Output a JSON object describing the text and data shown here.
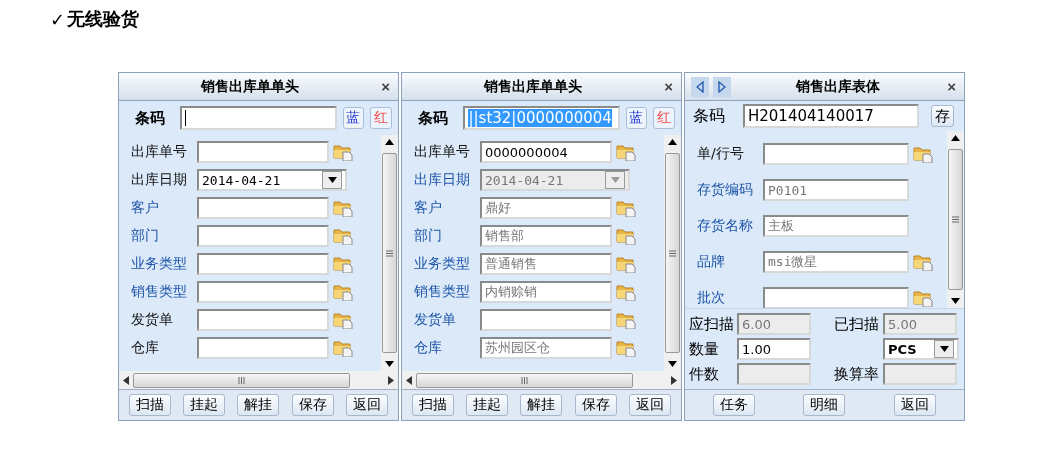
{
  "heading": {
    "mark": "✓",
    "text": "无线验货"
  },
  "panels": [
    {
      "kind": "header",
      "title": "销售出库单单头",
      "close": "×",
      "barcode": {
        "label": "条码"
      },
      "color_buttons": [
        {
          "label": "蓝",
          "color": "#1a2fd0"
        },
        {
          "label": "红",
          "color": "#f04848"
        }
      ],
      "fields": [
        {
          "label": "出库单号",
          "linked": false,
          "kind": "text",
          "lookup": true
        },
        {
          "label": "出库日期",
          "linked": false,
          "kind": "date",
          "value": "2014-04-21",
          "readonly": false
        },
        {
          "label": "客户",
          "linked": true,
          "kind": "text",
          "lookup": true
        },
        {
          "label": "部门",
          "linked": true,
          "kind": "text",
          "lookup": true
        },
        {
          "label": "业务类型",
          "linked": true,
          "kind": "text",
          "lookup": true
        },
        {
          "label": "销售类型",
          "linked": true,
          "kind": "text",
          "lookup": true
        },
        {
          "label": "发货单",
          "linked": false,
          "kind": "text",
          "lookup": true
        },
        {
          "label": "仓库",
          "linked": false,
          "kind": "text",
          "lookup": true
        }
      ],
      "buttons": [
        "扫描",
        "挂起",
        "解挂",
        "保存",
        "返回"
      ]
    },
    {
      "kind": "header",
      "title": "销售出库单单头",
      "close": "×",
      "barcode": {
        "label": "条码",
        "value": "||st32|0000000004",
        "selected": true
      },
      "color_buttons": [
        {
          "label": "蓝",
          "color": "#1a2fd0"
        },
        {
          "label": "红",
          "color": "#f04848"
        }
      ],
      "fields": [
        {
          "label": "出库单号",
          "linked": false,
          "kind": "text",
          "value": "0000000004",
          "readonly": false,
          "lookup": true
        },
        {
          "label": "出库日期",
          "linked": true,
          "kind": "date",
          "value": "2014-04-21",
          "readonly": true
        },
        {
          "label": "客户",
          "linked": true,
          "kind": "text",
          "value": "鼎好",
          "readonly": true,
          "lookup": true
        },
        {
          "label": "部门",
          "linked": true,
          "kind": "text",
          "value": "销售部",
          "readonly": true,
          "lookup": true
        },
        {
          "label": "业务类型",
          "linked": true,
          "kind": "text",
          "value": "普通销售",
          "readonly": true,
          "lookup": true
        },
        {
          "label": "销售类型",
          "linked": true,
          "kind": "text",
          "value": "内销赊销",
          "readonly": true,
          "lookup": true
        },
        {
          "label": "发货单",
          "linked": true,
          "kind": "text",
          "lookup": true
        },
        {
          "label": "仓库",
          "linked": true,
          "kind": "text",
          "value": "苏州园区仓",
          "readonly": true,
          "lookup": true
        }
      ],
      "buttons": [
        "扫描",
        "挂起",
        "解挂",
        "保存",
        "返回"
      ]
    },
    {
      "kind": "body",
      "title": "销售出库表体",
      "close": "×",
      "barcode": {
        "label": "条码",
        "value": "H201404140017",
        "selected": false
      },
      "save_button": "存",
      "fields": [
        {
          "label": "单/行号",
          "linked": false,
          "kind": "text",
          "lookup": true
        },
        {
          "label": "存货编码",
          "linked": true,
          "kind": "text",
          "value": "P0101",
          "readonly": true
        },
        {
          "label": "存货名称",
          "linked": true,
          "kind": "text",
          "value": "主板",
          "readonly": true
        },
        {
          "label": "品牌",
          "linked": true,
          "kind": "text",
          "value": "msi微星",
          "readonly": true,
          "lookup": true
        },
        {
          "label": "批次",
          "linked": true,
          "kind": "text",
          "lookup": true
        }
      ],
      "summary": [
        [
          {
            "label": "应扫描",
            "kind": "field",
            "value": "6.00",
            "disabled": true
          },
          {
            "label": "已扫描",
            "kind": "field",
            "value": "5.00",
            "disabled": true
          }
        ],
        [
          {
            "label": "数量",
            "kind": "field",
            "value": "1.00",
            "disabled": false
          },
          {
            "kind": "select",
            "value": "PCS",
            "disabled": false
          }
        ],
        [
          {
            "label": "件数",
            "kind": "field"
          },
          {
            "label": "换算率",
            "kind": "field"
          }
        ]
      ],
      "buttons": [
        "任务",
        "明细",
        "返回"
      ]
    }
  ]
}
